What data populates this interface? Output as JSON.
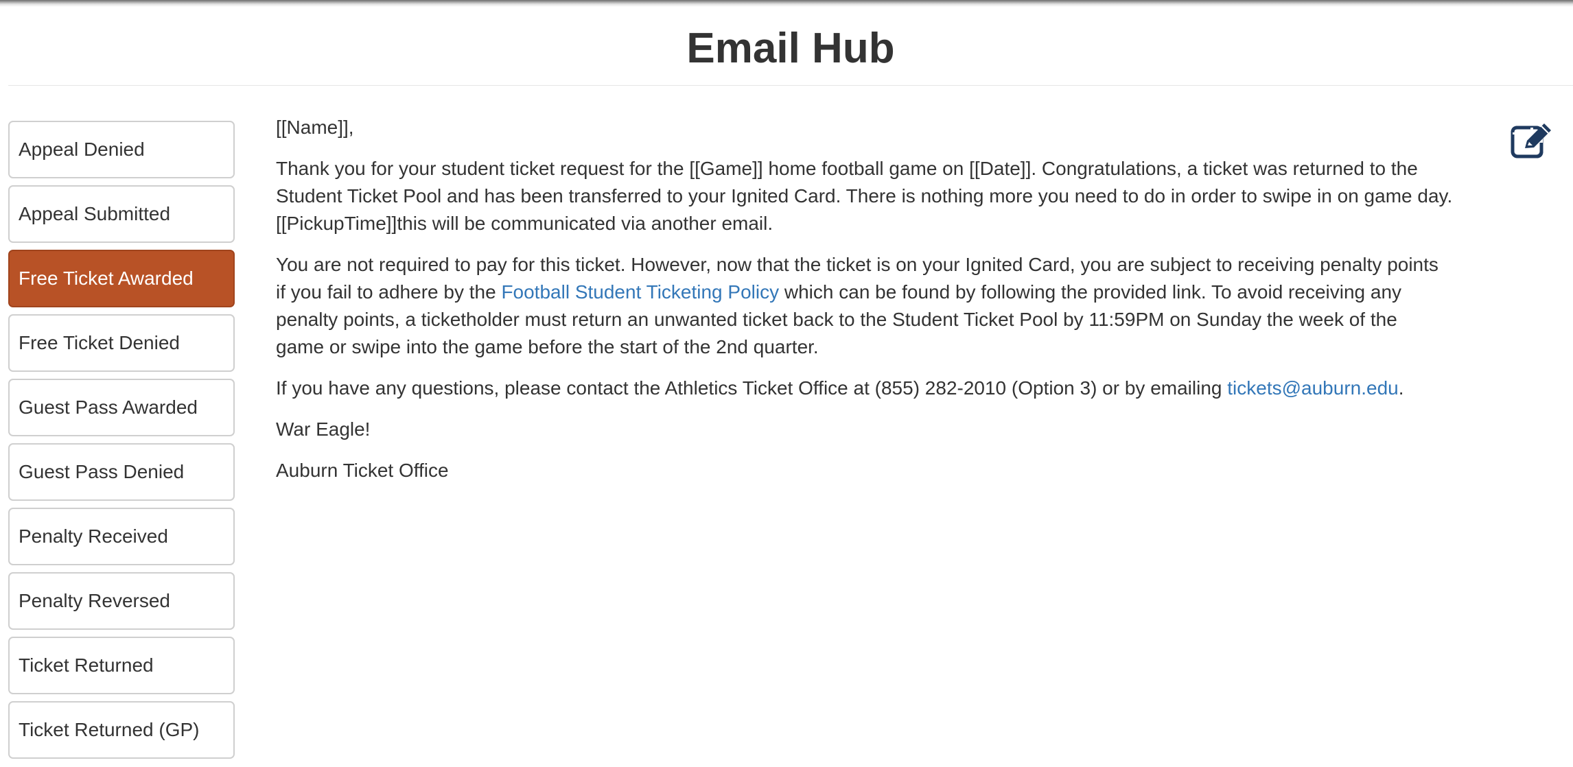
{
  "page": {
    "title": "Email Hub"
  },
  "sidebar": {
    "items": [
      {
        "label": "Appeal Denied",
        "active": false
      },
      {
        "label": "Appeal Submitted",
        "active": false
      },
      {
        "label": "Free Ticket Awarded",
        "active": true
      },
      {
        "label": "Free Ticket Denied",
        "active": false
      },
      {
        "label": "Guest Pass Awarded",
        "active": false
      },
      {
        "label": "Guest Pass Denied",
        "active": false
      },
      {
        "label": "Penalty Received",
        "active": false
      },
      {
        "label": "Penalty Reversed",
        "active": false
      },
      {
        "label": "Ticket Returned",
        "active": false
      },
      {
        "label": "Ticket Returned (GP)",
        "active": false
      }
    ]
  },
  "email": {
    "greeting": "[[Name]],",
    "para1_line1": "Thank you for your student ticket request for the [[Game]] home football game on [[Date]]. Congratulations, a ticket was returned to the",
    "para1_line2": "Student Ticket Pool and has been transferred to your Ignited Card. There is nothing more you need to do in order to swipe in on game day.",
    "para1_line3": "[[PickupTime]]this will be communicated via another email.",
    "para2_line1": "You are not required to pay for this ticket. However, now that the ticket is on your Ignited Card, you are subject to receiving penalty points",
    "para2_pre_link": "if you fail to adhere by the ",
    "policy_link": "Football Student Ticketing Policy",
    "para2_post_link": " which can be found by following the provided link.  To avoid receiving any",
    "para2_line3": "penalty points, a ticketholder must return an unwanted ticket back to the Student Ticket Pool by 11:59PM on Sunday the week of the",
    "para2_line4": "game or swipe into the game before the start of the 2nd quarter.",
    "para3_pre_link": "If you have any questions, please contact the Athletics Ticket Office at (855) 282-2010 (Option 3) or by emailing ",
    "email_link": "tickets@auburn.edu",
    "para3_post_link": ".",
    "signoff": "War Eagle!",
    "signature": "Auburn Ticket Office"
  },
  "icons": {
    "edit": "edit-icon"
  },
  "colors": {
    "active_item": "#b85226",
    "link": "#3377b8",
    "edit_icon": "#1f3a5f",
    "text": "#333333"
  }
}
